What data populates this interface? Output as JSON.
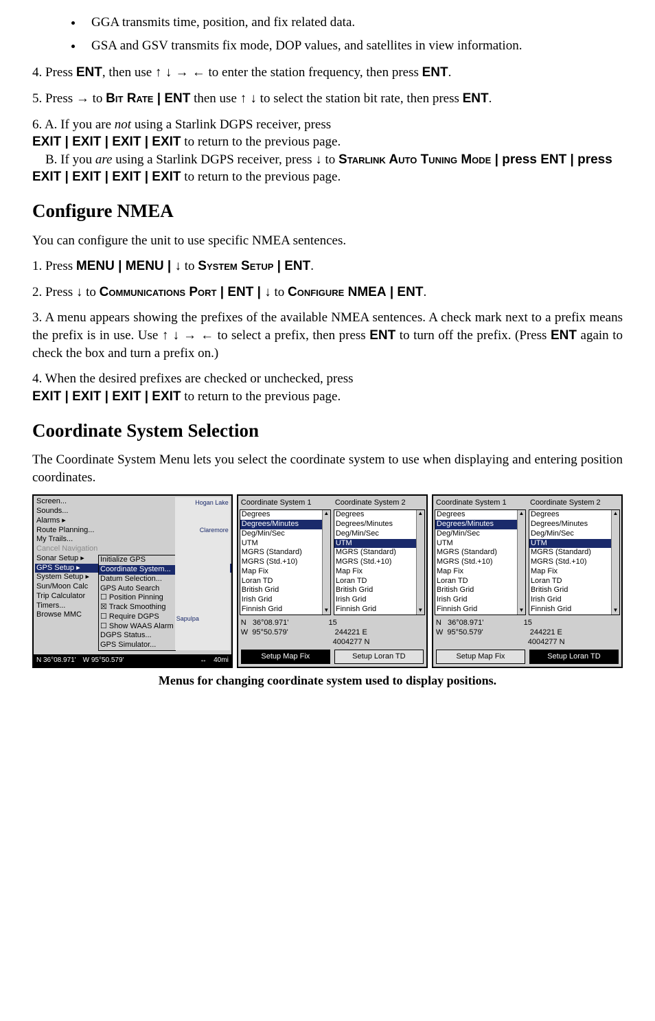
{
  "bullets": {
    "b1": "GGA transmits time, position, and fix related data.",
    "b2": "GSA and GSV transmits fix mode, DOP values, and satellites in view information."
  },
  "p4a": "4. Press ",
  "p4_ent": "ENT",
  "p4b": ", then use ",
  "arrows_udrl": "↑ ↓ → ←",
  "p4c": " to enter the station frequency, then press ",
  "p4_ent2": "ENT",
  "p4d": ".",
  "p5a": "5. Press ",
  "arrow_r": "→",
  "p5b": " to ",
  "p5_bitrate": "Bit Rate",
  "p5_pipe": " | ",
  "p5_ent": "ENT",
  "p5c": " then use ",
  "arrows_ud": "↑ ↓",
  "p5d": " to select the station bit rate, then press ",
  "p5_ent2": "ENT",
  "p5e": ".",
  "p6a1": "6. A. If you are ",
  "p6a_not": "not",
  "p6a2": " using a Starlink DGPS receiver, press ",
  "p6_exit4": "EXIT | EXIT | EXIT | EXIT",
  "p6a3": " to return to the previous page.",
  "p6b_indent": "    B. If you ",
  "p6b_are": "are",
  "p6b2": " using a Starlink DGPS receiver, press ",
  "arrow_d": "↓",
  "p6b3": " to ",
  "p6_starlink": "Starlink Auto Tuning Mode",
  "p6_press": " | press ",
  "p6_ent": "ENT",
  "p6_exit4b": "EXIT | EXIT | EXIT | EXIT",
  "p6b4": " to return to the previous page.",
  "h_configure": "Configure NMEA",
  "conf_intro": "You can configure the unit to use specific NMEA sentences.",
  "c1a": "1. Press ",
  "c1_menu": "MENU | MENU | ",
  "c1b": " to ",
  "c1_sys": "System Setup",
  "c1_ent": " | ENT",
  "c1c": ".",
  "c2a": "2. Press ",
  "c2b": " to ",
  "c2_comm": "Communications Port",
  "c2_ent": " | ENT | ",
  "c2c": " to ",
  "c2_conf": "Configure NMEA",
  "c2_ent2": " | ENT",
  "c2d": ".",
  "c3": "3. A menu appears showing the prefixes of the available NMEA sentences. A check mark next to a prefix means the prefix is in use. Use ",
  "arrows_udrl2": "↑ ↓ → ←",
  "c3b": " to select a prefix, then press ",
  "c3_ent": "ENT",
  "c3c": " to turn off the prefix. (Press ",
  "c3_ent2": "ENT",
  "c3d": " again to check the box and turn a prefix on.)",
  "c4a": "4. When the desired prefixes are checked or unchecked, press ",
  "c4_exit4": "EXIT | EXIT | EXIT | EXIT",
  "c4b": " to return to the previous page.",
  "h_coord": "Coordinate System Selection",
  "coord_intro": "The Coordinate System Menu lets you select the coordinate system to use when displaying and entering position coordinates.",
  "caption": "Menus for changing coordinate system used to display positions.",
  "left_menu": [
    "Screen...",
    "Sounds...",
    "Alarms",
    "Route Planning...",
    "My Trails...",
    "Cancel Navigation",
    "Sonar Setup",
    "GPS Setup",
    "System Setup",
    "Sun/Moon Calc",
    "Trip Calculator",
    "Timers...",
    "Browse MMC"
  ],
  "left_menu_sel": "GPS Setup",
  "submenu": [
    "Initialize GPS",
    "Coordinate System...",
    "Datum Selection...",
    "GPS Auto Search",
    "Position Pinning",
    "Track Smoothing",
    "Require DGPS",
    "Show WAAS Alarm",
    "DGPS Status...",
    "GPS Simulator..."
  ],
  "submenu_sel": "Coordinate System...",
  "map_labels": {
    "lake": "Hogan Lake",
    "creek": "Claremore",
    "town": "Sapulpa"
  },
  "status": {
    "lat": "N   36°08.971'",
    "lon": "W   95°50.579'",
    "scale": "40mi"
  },
  "coord_options": [
    "Degrees",
    "Degrees/Minutes",
    "Deg/Min/Sec",
    "UTM",
    "MGRS (Standard)",
    "MGRS (Std.+10)",
    "Map Fix",
    "Loran TD",
    "British Grid",
    "Irish Grid",
    "Finnish Grid"
  ],
  "col_titles": {
    "c1": "Coordinate System 1",
    "c2": "Coordinate System 2"
  },
  "sel_mid": {
    "c1": "Degrees/Minutes",
    "c2": "UTM"
  },
  "sel_right": {
    "c1": "Degrees/Minutes",
    "c2": "UTM"
  },
  "info_mid": [
    "N   36°08.971'",
    "W  95°50.579'",
    "15",
    "   244221 E",
    "  4004277 N"
  ],
  "info_right": [
    "N   36°08.971'",
    "W  95°50.579'",
    "15",
    "   244221 E",
    "  4004277 N"
  ],
  "btns": {
    "mapfix": "Setup Map Fix",
    "loran": "Setup Loran TD"
  }
}
